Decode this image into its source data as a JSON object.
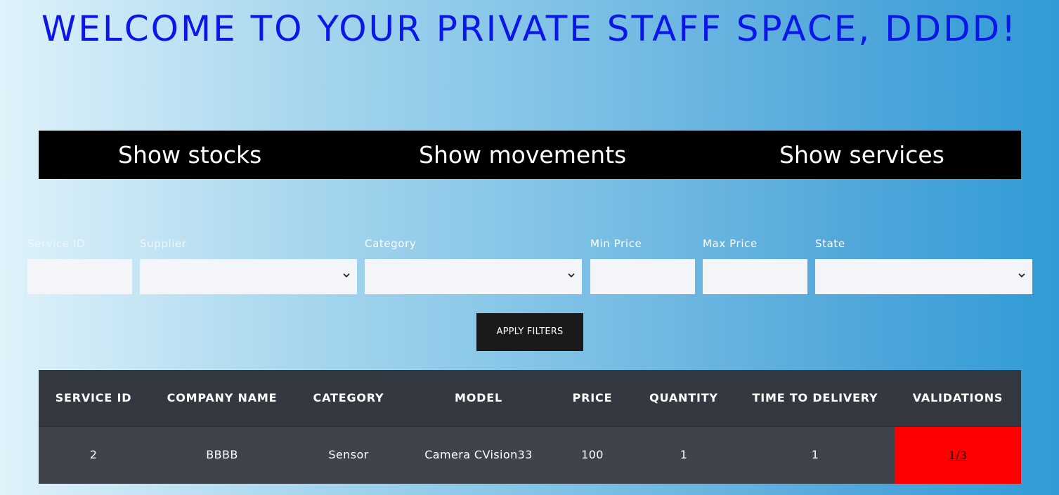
{
  "header": {
    "title": "WELCOME TO YOUR PRIVATE STAFF SPACE, DDDD!"
  },
  "nav": {
    "items": [
      {
        "label": "Show stocks"
      },
      {
        "label": "Show movements"
      },
      {
        "label": "Show services"
      }
    ]
  },
  "filters": {
    "service_id": {
      "label": "Service ID",
      "value": ""
    },
    "supplier": {
      "label": "Supplier",
      "value": ""
    },
    "category": {
      "label": "Category",
      "value": ""
    },
    "min_price": {
      "label": "Min Price",
      "value": ""
    },
    "max_price": {
      "label": "Max Price",
      "value": ""
    },
    "state": {
      "label": "State",
      "value": ""
    },
    "apply_label": "APPLY FILTERS"
  },
  "table": {
    "columns": [
      "SERVICE ID",
      "COMPANY NAME",
      "CATEGORY",
      "MODEL",
      "PRICE",
      "QUANTITY",
      "TIME TO DELIVERY",
      "VALIDATIONS"
    ],
    "rows": [
      [
        "2",
        "BBBB",
        "Sensor",
        "Camera CVision33",
        "100",
        "1",
        "1",
        "1/3"
      ]
    ]
  },
  "colors": {
    "title": "#0a17e8",
    "nav_background": "#000000",
    "table_header": "#343941",
    "table_row": "#3e434c",
    "validation_alert": "#ff0000"
  },
  "icons": {
    "select_arrow": "chevron-down-icon"
  }
}
